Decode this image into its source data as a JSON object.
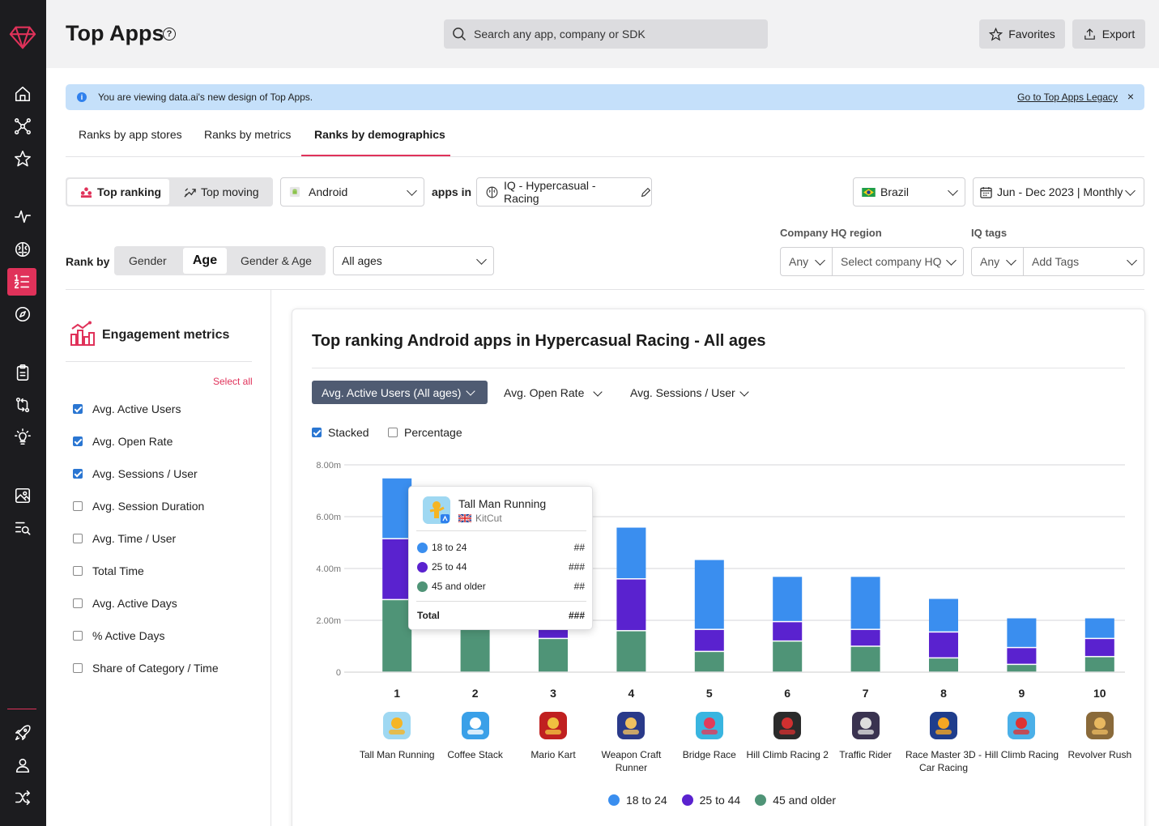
{
  "page": {
    "title": "Top Apps",
    "help_glyph": "?"
  },
  "search": {
    "placeholder": "Search any app, company or SDK"
  },
  "header_buttons": {
    "favorites": "Favorites",
    "export": "Export"
  },
  "banner": {
    "message": "You are viewing data.ai's new design of Top Apps.",
    "link": "Go to Top Apps Legacy",
    "info_glyph": "i",
    "close_glyph": "×"
  },
  "tabs": [
    {
      "label": "Ranks by app stores",
      "active": false
    },
    {
      "label": "Ranks by metrics",
      "active": false
    },
    {
      "label": "Ranks by demographics",
      "active": true
    }
  ],
  "filters": {
    "top_ranking": "Top ranking",
    "top_moving": "Top moving",
    "platform": "Android",
    "apps_in_label": "apps in",
    "category": "IQ - Hypercasual - Racing",
    "country": "Brazil",
    "date_range": "Jun - Dec 2023 | Monthly",
    "rank_by_label": "Rank by",
    "rank_by_options": [
      "Gender",
      "Age",
      "Gender & Age"
    ],
    "rank_by_selected": "Age",
    "age_select": "All ages",
    "company_hq_label": "Company HQ region",
    "company_hq_any": "Any",
    "company_hq_placeholder": "Select company HQ",
    "iq_tags_label": "IQ tags",
    "iq_tags_any": "Any",
    "iq_tags_placeholder": "Add Tags"
  },
  "engagement": {
    "title": "Engagement metrics",
    "select_all": "Select all",
    "metrics": [
      {
        "label": "Avg. Active Users",
        "checked": true
      },
      {
        "label": "Avg. Open Rate",
        "checked": true
      },
      {
        "label": "Avg. Sessions / User",
        "checked": true
      },
      {
        "label": "Avg. Session Duration",
        "checked": false
      },
      {
        "label": "Avg. Time / User",
        "checked": false
      },
      {
        "label": "Total Time",
        "checked": false
      },
      {
        "label": "Avg. Active Days",
        "checked": false
      },
      {
        "label": "% Active Days",
        "checked": false
      },
      {
        "label": "Share of Category / Time",
        "checked": false
      }
    ]
  },
  "chart_card": {
    "title": "Top ranking Android apps in Hypercasual Racing - All ages",
    "metric_selected": "Avg. Active Users (All ages)",
    "metric_2": "Avg. Open Rate",
    "metric_3": "Avg. Sessions / User",
    "stacked_label": "Stacked",
    "stacked_checked": true,
    "percentage_label": "Percentage",
    "percentage_checked": false
  },
  "chart_data": {
    "type": "bar",
    "stacked": true,
    "categories": [
      "1",
      "2",
      "3",
      "4",
      "5",
      "6",
      "7",
      "8",
      "9",
      "10"
    ],
    "app_names": [
      "Tall Man Running",
      "Coffee Stack",
      "Mario Kart",
      "Weapon Craft Runner",
      "Bridge Race",
      "Hill Climb Racing 2",
      "Traffic Rider",
      "Race Master 3D - Car Racing",
      "Hill Climb Racing",
      "Revolver Rush"
    ],
    "series": [
      {
        "name": "45 and older",
        "color": "#4f9477",
        "values": [
          2.8,
          1.7,
          1.3,
          1.6,
          0.8,
          1.2,
          1.0,
          0.55,
          0.3,
          0.6
        ]
      },
      {
        "name": "25 to 44",
        "color": "#5a22cf",
        "values": [
          2.35,
          1.7,
          1.25,
          2.0,
          0.85,
          0.75,
          0.65,
          1.0,
          0.65,
          0.7
        ]
      },
      {
        "name": "18 to 24",
        "color": "#3a8eef",
        "values": [
          2.35,
          1.5,
          1.6,
          2.0,
          2.7,
          1.75,
          2.05,
          1.3,
          1.15,
          0.8
        ]
      }
    ],
    "ylim": [
      0,
      8
    ],
    "yticks": [
      "0",
      "2.00m",
      "4.00m",
      "6.00m",
      "8.00m"
    ],
    "grid": true,
    "legend": "bottom-center"
  },
  "tooltip": {
    "app_name": "Tall Man Running",
    "publisher": "KitCut",
    "rows": [
      {
        "label": "18 to 24",
        "value": "##",
        "color": "#3a8eef"
      },
      {
        "label": "25 to 44",
        "value": "###",
        "color": "#5a22cf"
      },
      {
        "label": "45 and older",
        "value": "##",
        "color": "#4f9477"
      }
    ],
    "total_label": "Total",
    "total_value": "###"
  },
  "legend": [
    {
      "label": "18 to 24",
      "color": "#3a8eef"
    },
    {
      "label": "25 to 44",
      "color": "#5a22cf"
    },
    {
      "label": "45 and older",
      "color": "#4f9477"
    }
  ],
  "sidebar_icons": [
    "logo-icon",
    "home-icon",
    "network-icon",
    "star-icon",
    "activity-icon",
    "brain-icon",
    "ranking-icon",
    "compass-icon",
    "clipboard-icon",
    "compare-icon",
    "lightbulb-icon",
    "image-icon",
    "search-list-icon",
    "rocket-icon",
    "user-icon",
    "shuffle-icon"
  ]
}
